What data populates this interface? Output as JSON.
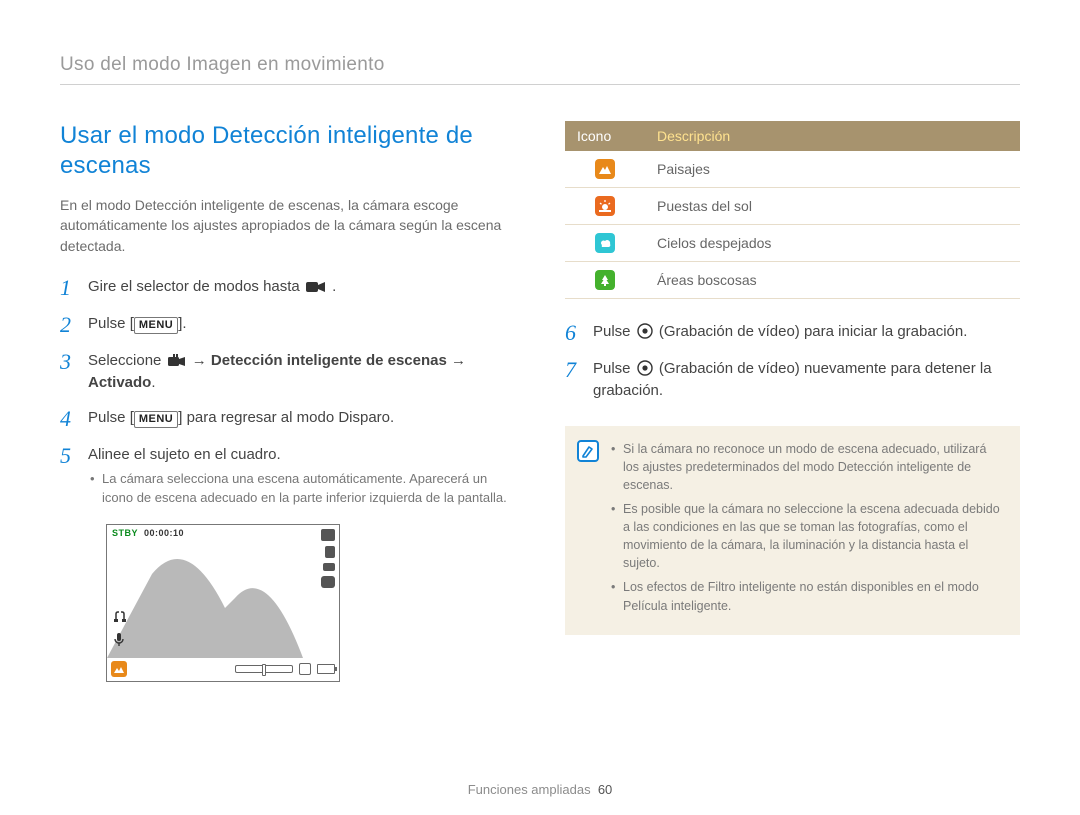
{
  "chapter_header": "Uso del modo Imagen en movimiento",
  "section_title": "Usar el modo Detección inteligente de escenas",
  "intro": "En el modo Detección inteligente de escenas, la cámara escoge automáticamente los ajustes apropiados de la cámara según la escena detectada.",
  "steps": {
    "s1": "Gire el selector de modos hasta ",
    "s1_icon": "video-mode-icon",
    "s1_end": " .",
    "s2_a": "Pulse [",
    "s2_menu": "MENU",
    "s2_b": "].",
    "s3_a": "Seleccione ",
    "s3_icon": "film-settings-icon",
    "s3_arrow1": " → ",
    "s3_bold1": "Detección inteligente de escenas",
    "s3_arrow2": " → ",
    "s3_bold2": "Activado",
    "s3_end": ".",
    "s4_a": "Pulse [",
    "s4_menu": "MENU",
    "s4_b": "] para regresar al modo Disparo.",
    "s5": "Alinee el sujeto en el cuadro.",
    "s5_sub1": "La cámara selecciona una escena automáticamente. Aparecerá un icono de escena adecuado en la parte inferior izquierda de la pantalla.",
    "s6_a": "Pulse ",
    "s6_b": " (Grabación de vídeo) para iniciar la grabación.",
    "s7_a": "Pulse ",
    "s7_b": " (Grabación de vídeo) nuevamente para detener la grabación."
  },
  "step_numbers": [
    "1",
    "2",
    "3",
    "4",
    "5",
    "6",
    "7"
  ],
  "preview": {
    "stby": "STBY",
    "timer": "00:00:10"
  },
  "scene_table": {
    "head_icon": "Icono",
    "head_desc": "Descripción",
    "rows": [
      {
        "icon": "landscape",
        "desc": "Paisajes"
      },
      {
        "icon": "sunset",
        "desc": "Puestas del sol"
      },
      {
        "icon": "sky",
        "desc": "Cielos despejados"
      },
      {
        "icon": "forest",
        "desc": "Áreas boscosas"
      }
    ]
  },
  "notes": [
    "Si la cámara no reconoce un modo de escena adecuado, utilizará los ajustes predeterminados del modo Detección inteligente de escenas.",
    "Es posible que la cámara no seleccione la escena adecuada debido a las condiciones en las que se toman las fotografías, como el movimiento de la cámara, la iluminación y la distancia hasta el sujeto.",
    "Los efectos de Filtro inteligente no están disponibles en el modo Película inteligente."
  ],
  "footer_label": "Funciones ampliadas",
  "footer_page": "60"
}
